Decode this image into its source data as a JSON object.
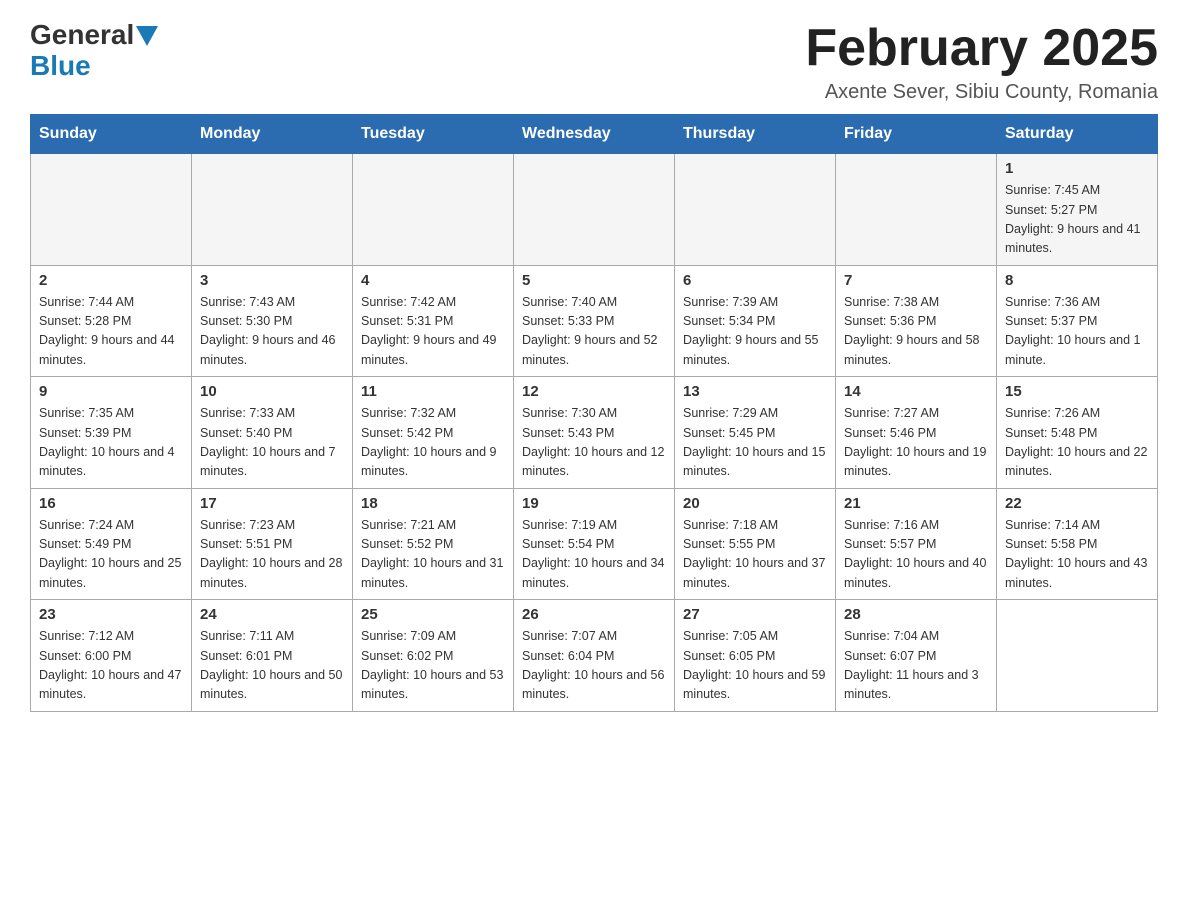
{
  "logo": {
    "general": "General",
    "triangle": "▶",
    "blue": "Blue"
  },
  "title": "February 2025",
  "location": "Axente Sever, Sibiu County, Romania",
  "days_of_week": [
    "Sunday",
    "Monday",
    "Tuesday",
    "Wednesday",
    "Thursday",
    "Friday",
    "Saturday"
  ],
  "weeks": [
    [
      {
        "day": "",
        "info": ""
      },
      {
        "day": "",
        "info": ""
      },
      {
        "day": "",
        "info": ""
      },
      {
        "day": "",
        "info": ""
      },
      {
        "day": "",
        "info": ""
      },
      {
        "day": "",
        "info": ""
      },
      {
        "day": "1",
        "info": "Sunrise: 7:45 AM\nSunset: 5:27 PM\nDaylight: 9 hours and 41 minutes."
      }
    ],
    [
      {
        "day": "2",
        "info": "Sunrise: 7:44 AM\nSunset: 5:28 PM\nDaylight: 9 hours and 44 minutes."
      },
      {
        "day": "3",
        "info": "Sunrise: 7:43 AM\nSunset: 5:30 PM\nDaylight: 9 hours and 46 minutes."
      },
      {
        "day": "4",
        "info": "Sunrise: 7:42 AM\nSunset: 5:31 PM\nDaylight: 9 hours and 49 minutes."
      },
      {
        "day": "5",
        "info": "Sunrise: 7:40 AM\nSunset: 5:33 PM\nDaylight: 9 hours and 52 minutes."
      },
      {
        "day": "6",
        "info": "Sunrise: 7:39 AM\nSunset: 5:34 PM\nDaylight: 9 hours and 55 minutes."
      },
      {
        "day": "7",
        "info": "Sunrise: 7:38 AM\nSunset: 5:36 PM\nDaylight: 9 hours and 58 minutes."
      },
      {
        "day": "8",
        "info": "Sunrise: 7:36 AM\nSunset: 5:37 PM\nDaylight: 10 hours and 1 minute."
      }
    ],
    [
      {
        "day": "9",
        "info": "Sunrise: 7:35 AM\nSunset: 5:39 PM\nDaylight: 10 hours and 4 minutes."
      },
      {
        "day": "10",
        "info": "Sunrise: 7:33 AM\nSunset: 5:40 PM\nDaylight: 10 hours and 7 minutes."
      },
      {
        "day": "11",
        "info": "Sunrise: 7:32 AM\nSunset: 5:42 PM\nDaylight: 10 hours and 9 minutes."
      },
      {
        "day": "12",
        "info": "Sunrise: 7:30 AM\nSunset: 5:43 PM\nDaylight: 10 hours and 12 minutes."
      },
      {
        "day": "13",
        "info": "Sunrise: 7:29 AM\nSunset: 5:45 PM\nDaylight: 10 hours and 15 minutes."
      },
      {
        "day": "14",
        "info": "Sunrise: 7:27 AM\nSunset: 5:46 PM\nDaylight: 10 hours and 19 minutes."
      },
      {
        "day": "15",
        "info": "Sunrise: 7:26 AM\nSunset: 5:48 PM\nDaylight: 10 hours and 22 minutes."
      }
    ],
    [
      {
        "day": "16",
        "info": "Sunrise: 7:24 AM\nSunset: 5:49 PM\nDaylight: 10 hours and 25 minutes."
      },
      {
        "day": "17",
        "info": "Sunrise: 7:23 AM\nSunset: 5:51 PM\nDaylight: 10 hours and 28 minutes."
      },
      {
        "day": "18",
        "info": "Sunrise: 7:21 AM\nSunset: 5:52 PM\nDaylight: 10 hours and 31 minutes."
      },
      {
        "day": "19",
        "info": "Sunrise: 7:19 AM\nSunset: 5:54 PM\nDaylight: 10 hours and 34 minutes."
      },
      {
        "day": "20",
        "info": "Sunrise: 7:18 AM\nSunset: 5:55 PM\nDaylight: 10 hours and 37 minutes."
      },
      {
        "day": "21",
        "info": "Sunrise: 7:16 AM\nSunset: 5:57 PM\nDaylight: 10 hours and 40 minutes."
      },
      {
        "day": "22",
        "info": "Sunrise: 7:14 AM\nSunset: 5:58 PM\nDaylight: 10 hours and 43 minutes."
      }
    ],
    [
      {
        "day": "23",
        "info": "Sunrise: 7:12 AM\nSunset: 6:00 PM\nDaylight: 10 hours and 47 minutes."
      },
      {
        "day": "24",
        "info": "Sunrise: 7:11 AM\nSunset: 6:01 PM\nDaylight: 10 hours and 50 minutes."
      },
      {
        "day": "25",
        "info": "Sunrise: 7:09 AM\nSunset: 6:02 PM\nDaylight: 10 hours and 53 minutes."
      },
      {
        "day": "26",
        "info": "Sunrise: 7:07 AM\nSunset: 6:04 PM\nDaylight: 10 hours and 56 minutes."
      },
      {
        "day": "27",
        "info": "Sunrise: 7:05 AM\nSunset: 6:05 PM\nDaylight: 10 hours and 59 minutes."
      },
      {
        "day": "28",
        "info": "Sunrise: 7:04 AM\nSunset: 6:07 PM\nDaylight: 11 hours and 3 minutes."
      },
      {
        "day": "",
        "info": ""
      }
    ]
  ]
}
